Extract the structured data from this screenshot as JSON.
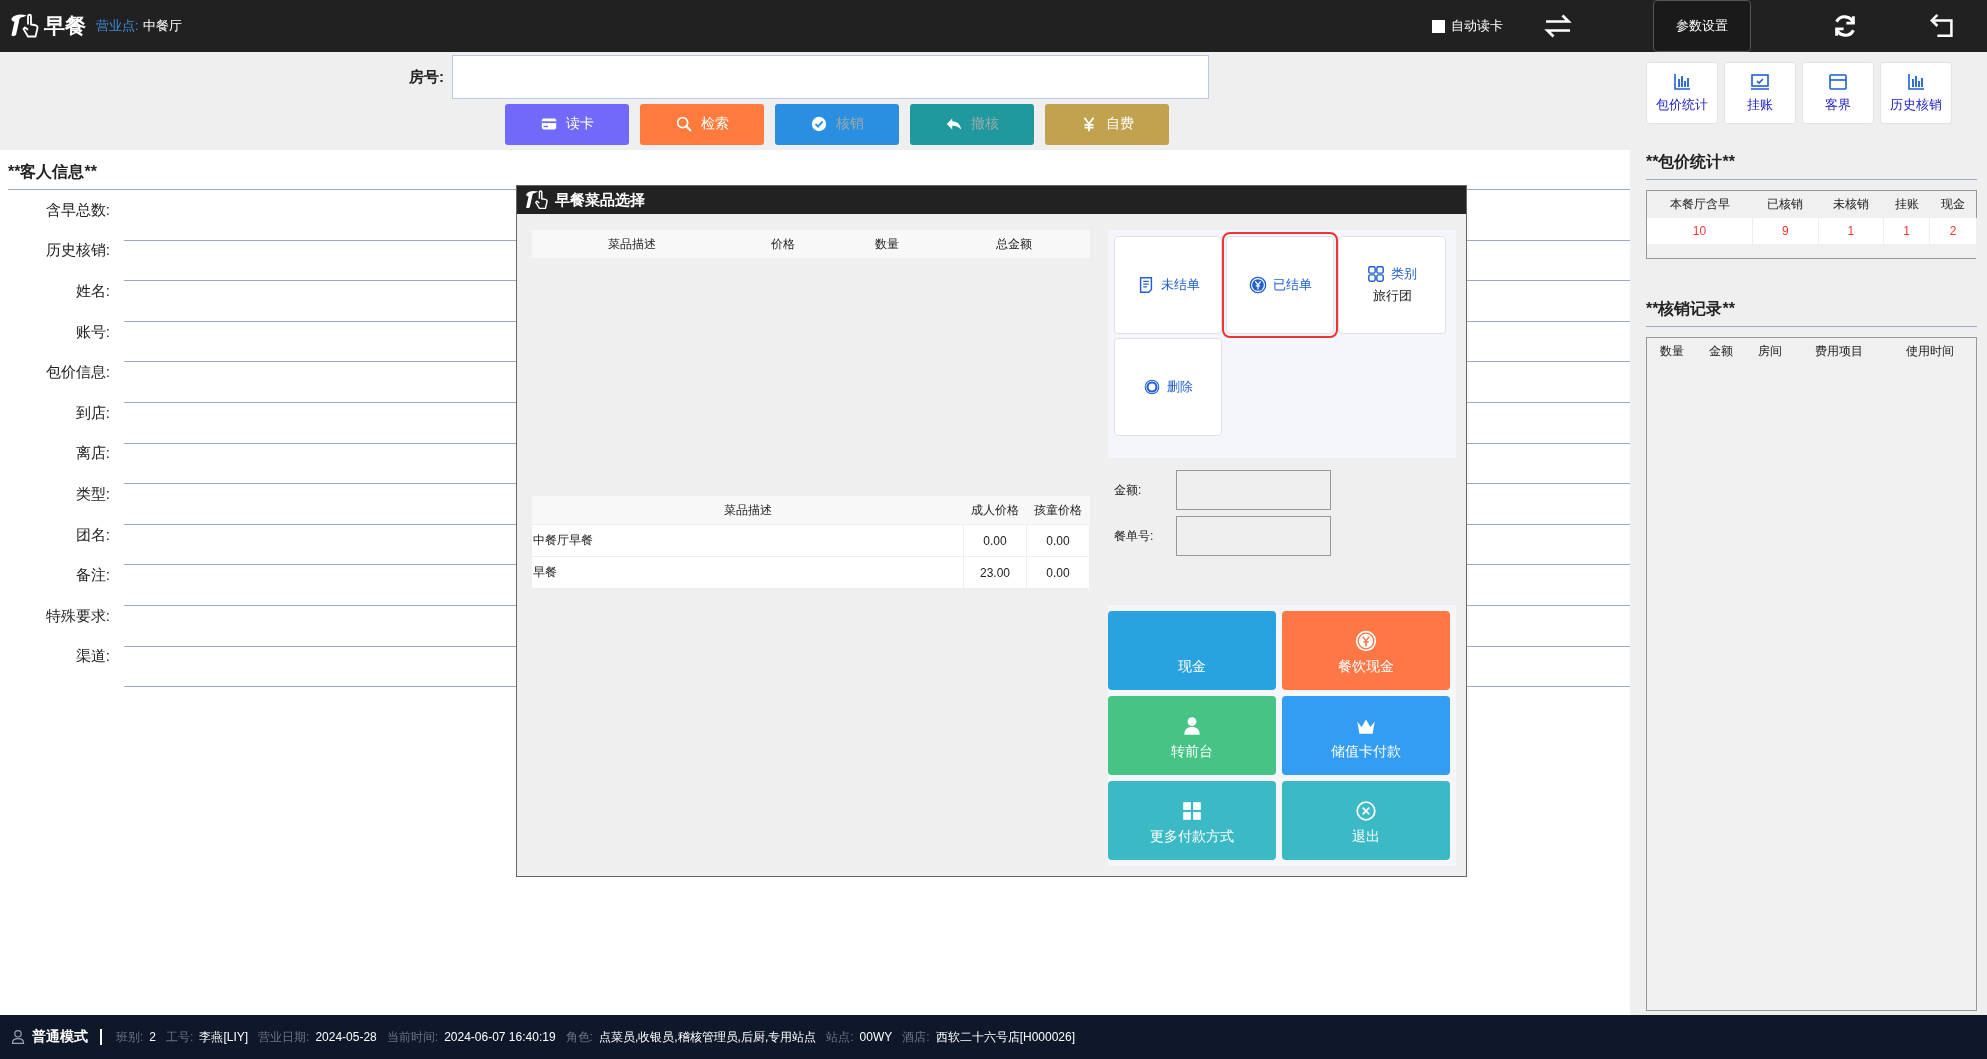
{
  "header": {
    "app_title": "早餐",
    "outlet_label": "营业点:",
    "outlet": "中餐厅",
    "auto_read_card": {
      "label": "自动读卡",
      "checked": false
    },
    "settings_button": "参数设置"
  },
  "room": {
    "label": "房号:"
  },
  "actions": [
    {
      "label": "读卡",
      "kind": "card",
      "color": "#7069fa",
      "disabled": false
    },
    {
      "label": "检索",
      "kind": "search",
      "color": "#ff7a3d",
      "disabled": false
    },
    {
      "label": "核销",
      "kind": "check",
      "color": "#2a8fe0",
      "disabled": true
    },
    {
      "label": "撤核",
      "kind": "undo",
      "color": "#20999e",
      "disabled": true
    },
    {
      "label": "自费",
      "kind": "yen",
      "color": "#c0a24f",
      "disabled": false
    }
  ],
  "guest_info": {
    "title": "**客人信息**",
    "fields": [
      {
        "label": "含早总数:"
      },
      {
        "label": "历史核销:"
      },
      {
        "label": "姓名:"
      },
      {
        "label": "账号:"
      },
      {
        "label": "包价信息:"
      },
      {
        "label": "到店:"
      },
      {
        "label": "离店:"
      },
      {
        "label": "类型:"
      },
      {
        "label": "团名:"
      },
      {
        "label": "备注:"
      },
      {
        "label": "特殊要求:"
      },
      {
        "label": "渠道:"
      }
    ]
  },
  "side_buttons": [
    {
      "label": "包价统计",
      "kind": "chart"
    },
    {
      "label": "挂账",
      "kind": "monitor"
    },
    {
      "label": "客界",
      "kind": "window"
    },
    {
      "label": "历史核销",
      "kind": "chart"
    }
  ],
  "package_stats": {
    "title": "**包价统计**",
    "columns": [
      "本餐厅含早",
      "已核销",
      "未核销",
      "挂账",
      "现金"
    ],
    "rows": [
      [
        "10",
        "9",
        "1",
        "1",
        "2"
      ]
    ]
  },
  "writeoff_records": {
    "title": "**核销记录**",
    "columns": [
      "数量",
      "金额",
      "房间",
      "费用项目",
      "使用时间"
    ]
  },
  "dialog": {
    "title": "早餐菜品选择",
    "order_table": {
      "columns": [
        "菜品描述",
        "价格",
        "数量",
        "总金额"
      ]
    },
    "menu_table": {
      "columns": [
        "菜品描述",
        "成人价格",
        "孩童价格"
      ],
      "rows": [
        [
          "中餐厅早餐",
          "0.00",
          "0.00"
        ],
        [
          "早餐",
          "23.00",
          "0.00"
        ]
      ]
    },
    "bill_buttons": [
      {
        "label": "未结单",
        "kind": "doc",
        "selected": false
      },
      {
        "label": "已结单",
        "kind": "yen",
        "selected": true
      },
      {
        "label": "类别",
        "kind": "grid",
        "value": "旅行团",
        "selected": false
      },
      {
        "label": "删除",
        "kind": "ring",
        "selected": false
      }
    ],
    "fields": [
      {
        "label": "金额:"
      },
      {
        "label": "餐单号:"
      }
    ],
    "payments": [
      {
        "label": "现金",
        "kind": "none",
        "color": "#29a3df"
      },
      {
        "label": "餐饮现金",
        "kind": "yen",
        "color": "#ff7744"
      },
      {
        "label": "转前台",
        "kind": "person",
        "color": "#45c486"
      },
      {
        "label": "储值卡付款",
        "kind": "crown",
        "color": "#339cf3"
      },
      {
        "label": "更多付款方式",
        "kind": "grid",
        "color": "#3bbac6"
      },
      {
        "label": "退出",
        "kind": "close",
        "color": "#3bbac6"
      }
    ]
  },
  "status_bar": {
    "mode": "普通模式",
    "items": [
      {
        "label": "班别:",
        "value": "2"
      },
      {
        "label": "工号:",
        "value": "李燕[LIY]"
      },
      {
        "label": "营业日期:",
        "value": "2024-05-28"
      },
      {
        "label": "当前时间:",
        "value": "2024-06-07 16:40:19"
      },
      {
        "label": "角色:",
        "value": "点菜员,收银员,稽核管理员,后厨,专用站点"
      },
      {
        "label": "站点:",
        "value": "00WY"
      },
      {
        "label": "酒店:",
        "value": "西软二十六号店[H000026]"
      }
    ]
  }
}
